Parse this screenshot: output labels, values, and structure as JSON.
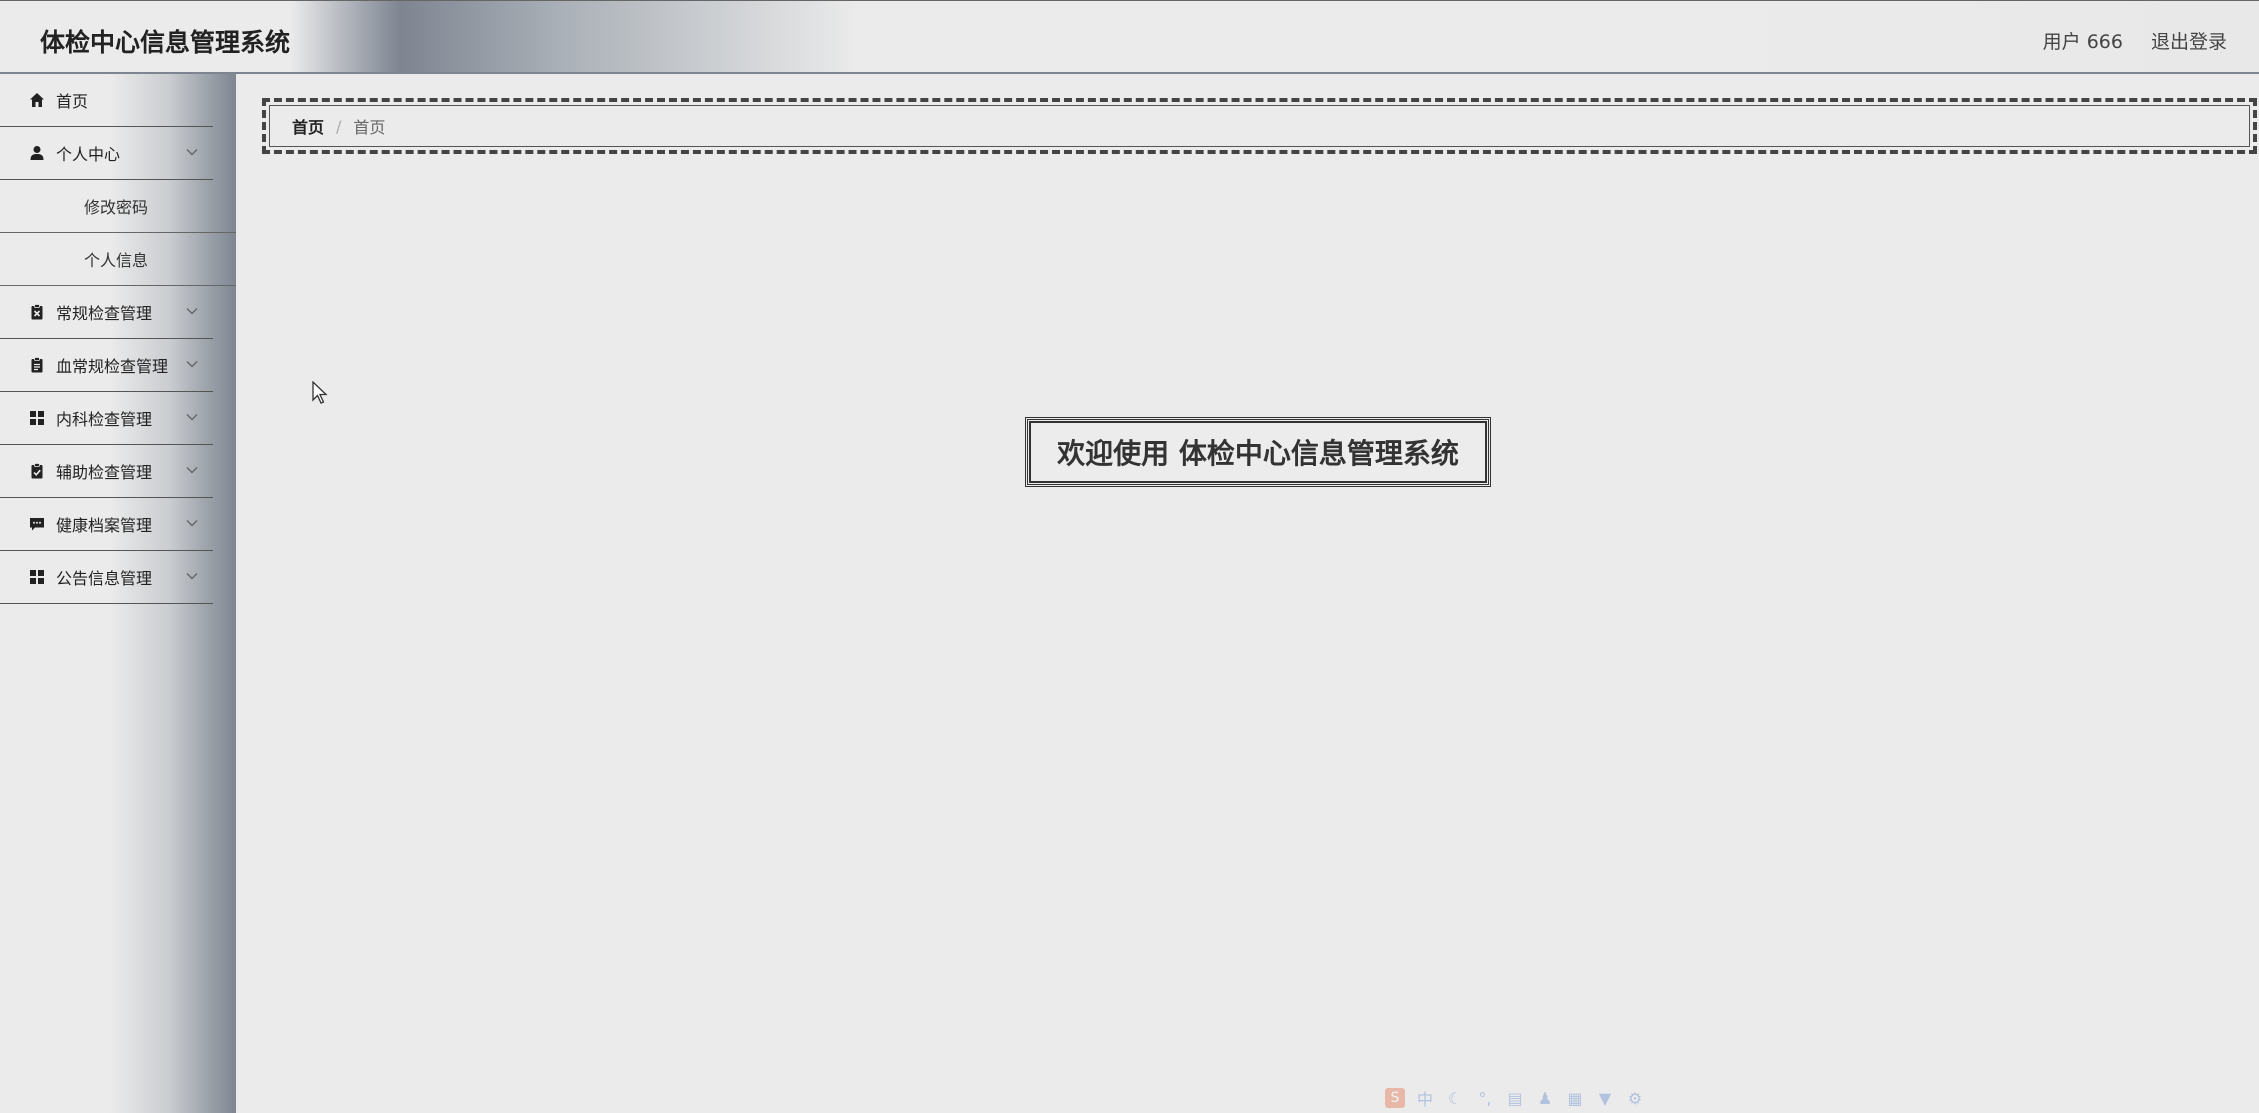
{
  "header": {
    "title": "体检中心信息管理系统",
    "user_label": "用户 666",
    "logout_label": "退出登录"
  },
  "sidebar": {
    "items": [
      {
        "label": "首页",
        "icon": "home-icon"
      },
      {
        "label": "个人中心",
        "icon": "user-icon",
        "expanded": true,
        "children": [
          {
            "label": "修改密码"
          },
          {
            "label": "个人信息"
          }
        ]
      },
      {
        "label": "常规检查管理",
        "icon": "clipboard-x-icon"
      },
      {
        "label": "血常规检查管理",
        "icon": "clipboard-icon"
      },
      {
        "label": "内科检查管理",
        "icon": "grid-icon"
      },
      {
        "label": "辅助检查管理",
        "icon": "clipboard-check-icon"
      },
      {
        "label": "健康档案管理",
        "icon": "message-icon"
      },
      {
        "label": "公告信息管理",
        "icon": "grid-icon"
      }
    ]
  },
  "breadcrumb": {
    "home": "首页",
    "separator": "/",
    "current": "首页"
  },
  "main": {
    "welcome": "欢迎使用 体检中心信息管理系统"
  },
  "ime": {
    "logo": "S",
    "mode": "中"
  }
}
